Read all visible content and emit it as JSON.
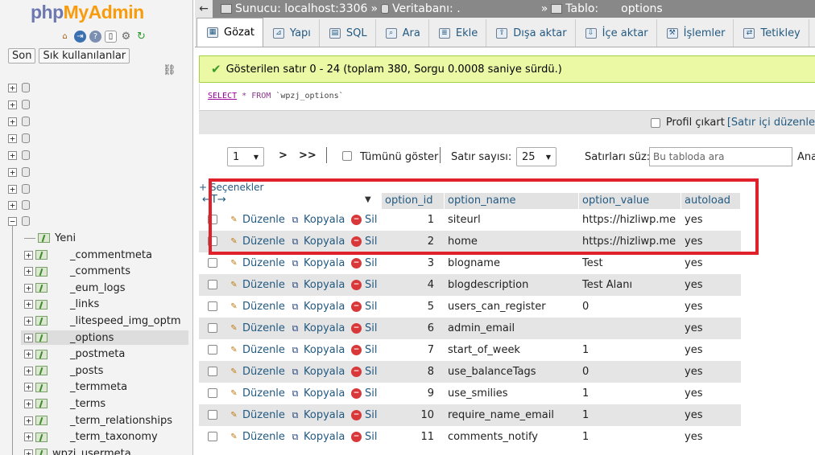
{
  "logo": {
    "php": "php",
    "myadmin": "MyAdmin"
  },
  "nav_icons": [
    "home-icon",
    "logout-icon",
    "help-icon",
    "docs-icon",
    "settings-icon",
    "reload-icon"
  ],
  "nav_tabs": {
    "recent": "Son",
    "favorites": "Sık kullanılanlar"
  },
  "tree": {
    "new_label": "Yeni",
    "tables": [
      "_commentmeta",
      "_comments",
      "_eum_logs",
      "_links",
      "_litespeed_img_optm",
      "_options",
      "_postmeta",
      "_posts",
      "_termmeta",
      "_terms",
      "_term_relationships",
      "_term_taxonomy",
      "wpzj_usermeta"
    ],
    "selected_table": "_options"
  },
  "breadcrumb": {
    "server": "Sunucu: localhost:3306",
    "database": "Veritabanı: .",
    "table": "Tablo:",
    "table_name": "options"
  },
  "tabs": [
    "Gözat",
    "Yapı",
    "SQL",
    "Ara",
    "Ekle",
    "Dışa aktar",
    "İçe aktar",
    "İşlemler",
    "Tetikley"
  ],
  "active_tab": "Gözat",
  "success_message": "Gösterilen satır 0 - 24 (toplam 380, Sorgu 0.0008 saniye sürdü.)",
  "sql": {
    "select": "SELECT",
    "star": "*",
    "from": "FROM",
    "table": "`wpzj_options`"
  },
  "profiling": {
    "label": "Profil çıkart",
    "inline_edit": "[Satır içi düzenle"
  },
  "pager": {
    "page": "1",
    "next": ">",
    "last": ">>",
    "show_all": "Tümünü göster",
    "rows_label": "Satır sayısı:",
    "rows_value": "25",
    "filter_label": "Satırları süz:",
    "filter_placeholder": "Bu tabloda ara",
    "extra": "Ana"
  },
  "options_toggle": "+ Seçenekler",
  "arrows": "←T→",
  "columns": [
    "option_id",
    "option_name",
    "option_value",
    "autoload"
  ],
  "actions": {
    "edit": "Düzenle",
    "copy": "Kopyala",
    "delete": "Sil"
  },
  "rows": [
    {
      "id": "1",
      "name": "siteurl",
      "value": "https://hizliwp.me",
      "autoload": "yes"
    },
    {
      "id": "2",
      "name": "home",
      "value": "https://hizliwp.me",
      "autoload": "yes"
    },
    {
      "id": "3",
      "name": "blogname",
      "value": "Test",
      "autoload": "yes"
    },
    {
      "id": "4",
      "name": "blogdescription",
      "value": "Test Alanı",
      "autoload": "yes"
    },
    {
      "id": "5",
      "name": "users_can_register",
      "value": "0",
      "autoload": "yes"
    },
    {
      "id": "6",
      "name": "admin_email",
      "value": "",
      "autoload": "yes"
    },
    {
      "id": "7",
      "name": "start_of_week",
      "value": "1",
      "autoload": "yes"
    },
    {
      "id": "8",
      "name": "use_balanceTags",
      "value": "0",
      "autoload": "yes"
    },
    {
      "id": "9",
      "name": "use_smilies",
      "value": "1",
      "autoload": "yes"
    },
    {
      "id": "10",
      "name": "require_name_email",
      "value": "1",
      "autoload": "yes"
    },
    {
      "id": "11",
      "name": "comments_notify",
      "value": "1",
      "autoload": "yes"
    }
  ],
  "colors": {
    "link": "#235a81",
    "highlight": "#e0202a",
    "success_bg": "#ebf8a4"
  }
}
